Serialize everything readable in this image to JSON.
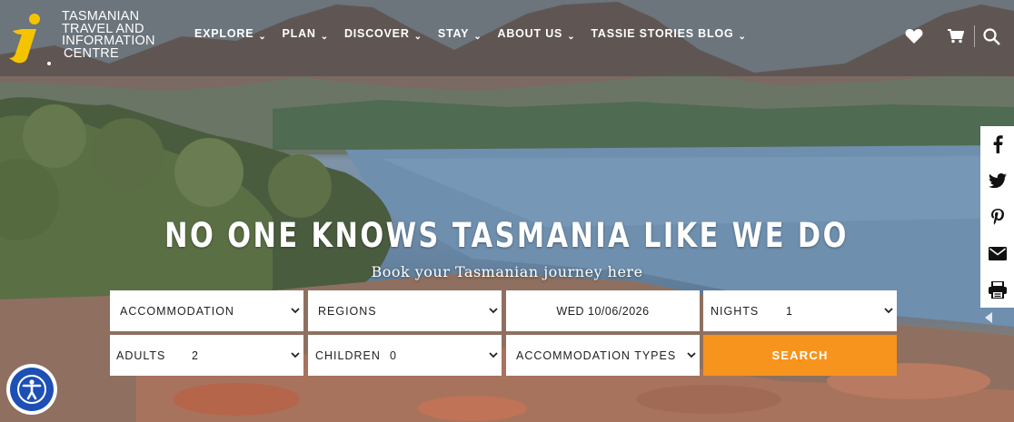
{
  "brand": {
    "lines": [
      "TASMANIAN",
      "TRAVEL AND",
      "INFORMATION",
      "CENTRE"
    ],
    "accent_color": "#f5c400",
    "icon": "info-i-logo"
  },
  "nav": {
    "items": [
      {
        "label": "EXPLORE"
      },
      {
        "label": "PLAN"
      },
      {
        "label": "DISCOVER"
      },
      {
        "label": "STAY"
      },
      {
        "label": "ABOUT US"
      },
      {
        "label": "TASSIE STORIES BLOG"
      }
    ],
    "icons": [
      "heart-icon",
      "cart-icon",
      "search-icon"
    ]
  },
  "social": [
    "facebook-icon",
    "twitter-icon",
    "pinterest-icon",
    "email-icon",
    "print-icon"
  ],
  "hero": {
    "headline": "NO ONE KNOWS TASMANIA LIKE WE DO",
    "subheadline": "Book your Tasmanian journey here"
  },
  "search_form": {
    "category": "ACCOMMODATION",
    "regions": "REGIONS",
    "date": "WED 10/06/2026",
    "nights_label": "NIGHTS",
    "nights_value": "1",
    "adults_label": "ADULTS",
    "adults_value": "2",
    "children_label": "CHILDREN",
    "children_value": "0",
    "types": "ACCOMMODATION TYPES",
    "search_label": "SEARCH",
    "button_color": "#f7941d"
  },
  "accessibility": {
    "icon": "accessibility-icon",
    "color": "#1d4fb5"
  }
}
